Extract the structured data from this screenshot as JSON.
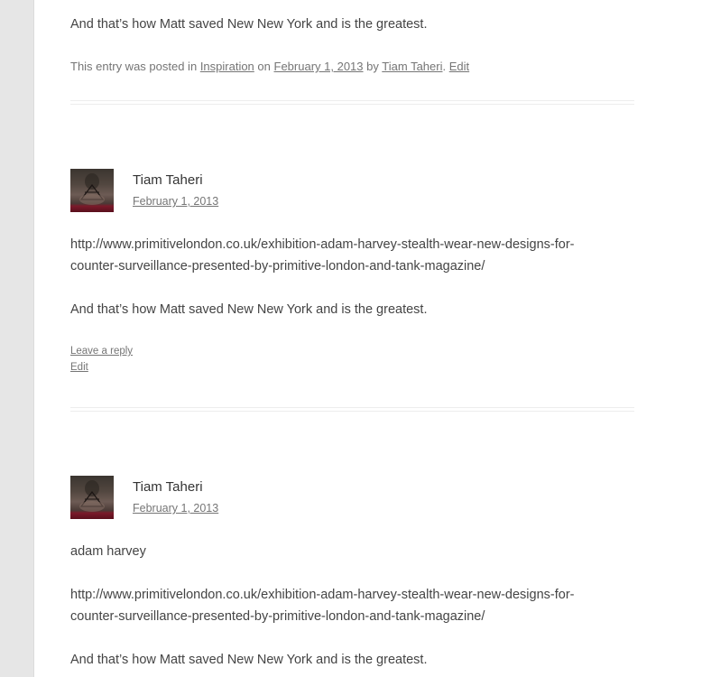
{
  "post": {
    "closing_line": "And that’s how Matt saved New New York and is the greatest.",
    "meta": {
      "prefix": "This entry was posted in",
      "category": "Inspiration",
      "on_word": "on",
      "date": "February 1, 2013",
      "by_word": "by",
      "author": "Tiam Taheri",
      "period": ".",
      "edit": "Edit"
    }
  },
  "comments": [
    {
      "author": "Tiam Taheri",
      "date": "February 1, 2013",
      "url_line1": "http://www.primitivelondon.co.uk/exhibition-adam-harvey-stealth-wear-new-designs-for-",
      "url_line2": "counter-surveillance-presented-by-primitive-london-and-tank-magazine/",
      "closing_line": "And that’s how Matt saved New New York and is the greatest.",
      "reply": "Leave a reply",
      "edit": "Edit"
    },
    {
      "author": "Tiam Taheri",
      "date": "February 1, 2013",
      "title_line": "adam harvey",
      "url_line1": "http://www.primitivelondon.co.uk/exhibition-adam-harvey-stealth-wear-new-designs-for-",
      "url_line2": "counter-surveillance-presented-by-primitive-london-and-tank-magazine/",
      "closing_line": "And that’s how Matt saved New New York and is the greatest."
    }
  ]
}
